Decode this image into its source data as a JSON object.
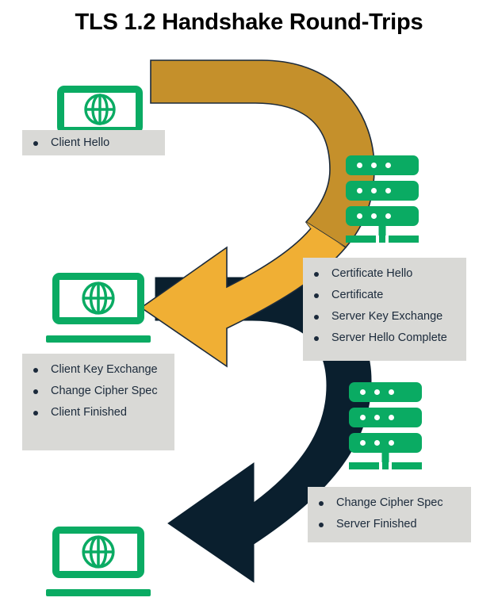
{
  "title": "TLS 1.2 Handshake Round-Trips",
  "colors": {
    "green": "#0aab63",
    "gold_dark": "#c5902b",
    "gold_light": "#f0af34",
    "navy": "#0a1f2e",
    "box_gray": "#d9d9d6",
    "text": "#1b2a3b",
    "title_text": "#000000",
    "background": "#ffffff"
  },
  "icons": [
    {
      "id": "client-laptop-top",
      "name": "laptop-globe-icon",
      "role": "client"
    },
    {
      "id": "server-top",
      "name": "server-rack-icon",
      "role": "server"
    },
    {
      "id": "client-laptop-middle",
      "name": "laptop-globe-icon",
      "role": "client"
    },
    {
      "id": "server-bottom",
      "name": "server-rack-icon",
      "role": "server"
    },
    {
      "id": "client-laptop-bottom",
      "name": "laptop-globe-icon",
      "role": "client"
    }
  ],
  "arrows": [
    {
      "id": "client-to-server-roundtrip",
      "name": "gold-round-trip-arrow",
      "color_top": "#c5902b",
      "color_bottom": "#f0af34",
      "direction": "clockwise-return-left"
    },
    {
      "id": "server-to-client-roundtrip",
      "name": "navy-round-trip-arrow",
      "color_top": "#0a1f2e",
      "color_bottom": "#0a1f2e",
      "direction": "clockwise-return-left"
    }
  ],
  "messages": [
    {
      "id": "client-hello-box",
      "name": "message-box-client-hello",
      "items": [
        "Client Hello"
      ]
    },
    {
      "id": "server-hello-box",
      "name": "message-box-server-hello",
      "items": [
        "Certificate Hello",
        "Certificate",
        "Server Key Exchange",
        "Server Hello Complete"
      ]
    },
    {
      "id": "client-key-exchange-box",
      "name": "message-box-client-key-exchange",
      "items": [
        "Client Key Exchange",
        "Change Cipher Spec",
        "Client Finished"
      ]
    },
    {
      "id": "server-finished-box",
      "name": "message-box-server-finished",
      "items": [
        "Change Cipher Spec",
        "Server Finished"
      ]
    }
  ]
}
